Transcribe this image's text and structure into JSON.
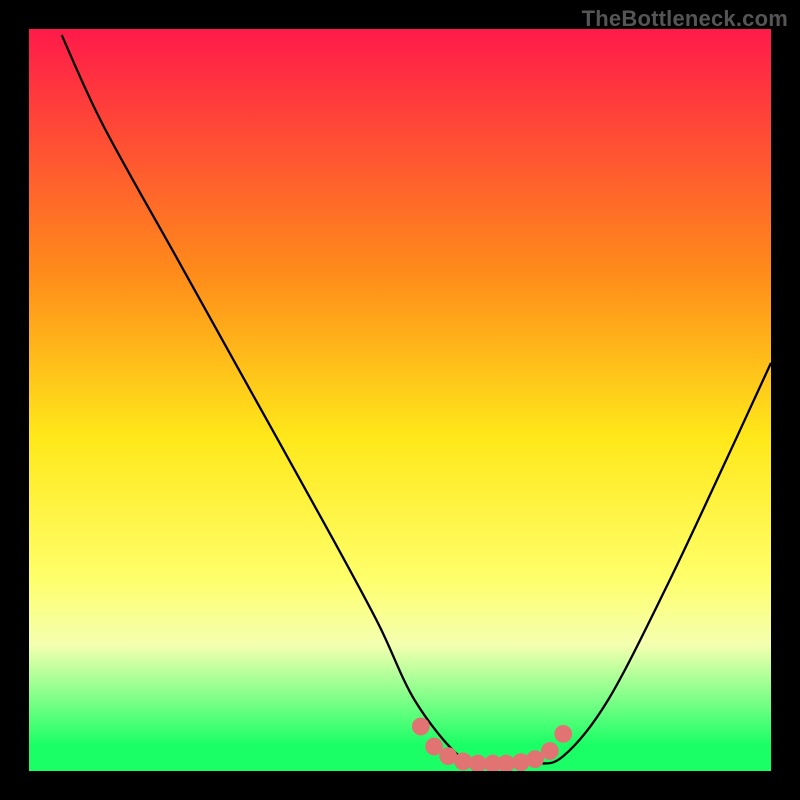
{
  "watermark": "TheBottleneck.com",
  "chart_data": {
    "type": "line",
    "title": "",
    "xlabel": "",
    "ylabel": "",
    "xlim": [
      0,
      1
    ],
    "ylim": [
      0,
      1
    ],
    "gradient_stops": [
      {
        "offset": 0.0,
        "color": "#ff1a4a"
      },
      {
        "offset": 0.33,
        "color": "#ff8c1a"
      },
      {
        "offset": 0.55,
        "color": "#ffe81a"
      },
      {
        "offset": 0.74,
        "color": "#ffff6a"
      },
      {
        "offset": 0.83,
        "color": "#f4ffb0"
      },
      {
        "offset": 0.965,
        "color": "#1aff66"
      },
      {
        "offset": 1.0,
        "color": "#1aff66"
      }
    ],
    "series": [
      {
        "name": "bottleneck-curve",
        "color": "#000000",
        "x": [
          0.044,
          0.1,
          0.2,
          0.3,
          0.4,
          0.47,
          0.52,
          0.58,
          0.62,
          0.68,
          0.72,
          0.78,
          0.86,
          0.94,
          1.0
        ],
        "y": [
          0.992,
          0.87,
          0.69,
          0.51,
          0.33,
          0.2,
          0.095,
          0.02,
          0.01,
          0.01,
          0.02,
          0.095,
          0.25,
          0.42,
          0.55
        ]
      }
    ],
    "markers": {
      "name": "flat-region",
      "color": "#e27373",
      "radius_frac": 0.012,
      "x": [
        0.528,
        0.546,
        0.565,
        0.585,
        0.605,
        0.625,
        0.643,
        0.663,
        0.682,
        0.702,
        0.72
      ],
      "y": [
        0.06,
        0.033,
        0.02,
        0.013,
        0.01,
        0.01,
        0.01,
        0.012,
        0.016,
        0.027,
        0.05
      ]
    }
  }
}
